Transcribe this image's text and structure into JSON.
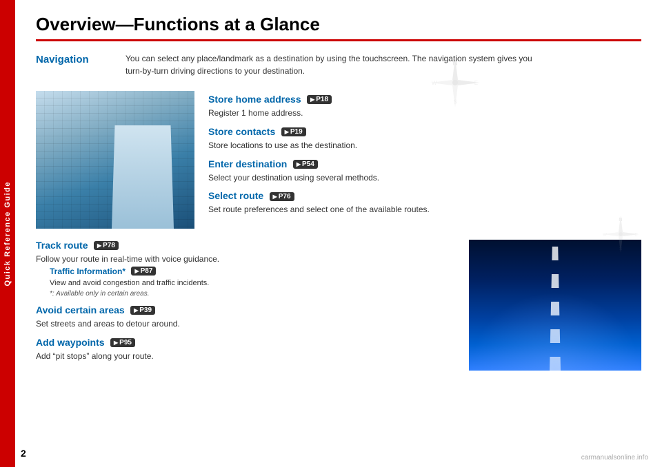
{
  "page": {
    "number": "2",
    "sidebar_label": "Quick Reference Guide",
    "title": "Overview—Functions at a Glance"
  },
  "navigation_section": {
    "label": "Navigation",
    "description_line1": "You can select any place/landmark as a destination by using the touchscreen. The navigation system gives you",
    "description_line2": "turn-by-turn driving directions to your destination."
  },
  "features": [
    {
      "title": "Store home address",
      "badge": "P18",
      "description": "Register 1 home address."
    },
    {
      "title": "Store contacts",
      "badge": "P19",
      "description": "Store locations to use as the destination."
    },
    {
      "title": "Enter destination",
      "badge": "P54",
      "description": "Select your destination using several methods."
    },
    {
      "title": "Select route",
      "badge": "P76",
      "description": "Set route preferences and select one of the available routes."
    }
  ],
  "lower_features": [
    {
      "title": "Track route",
      "badge": "P78",
      "description": "Follow your route in real-time with voice guidance.",
      "sub_feature": {
        "title": "Traffic Information*",
        "badge": "P87",
        "description": "View and avoid congestion and traffic incidents.",
        "note": "*: Available only in certain areas."
      }
    },
    {
      "title": "Avoid certain areas",
      "badge": "P39",
      "description": "Set streets and areas to detour around.",
      "sub_feature": null
    },
    {
      "title": "Add waypoints",
      "badge": "P95",
      "description": "Add “pit stops” along your route.",
      "sub_feature": null
    }
  ],
  "watermark": "carmanualsonline.info"
}
